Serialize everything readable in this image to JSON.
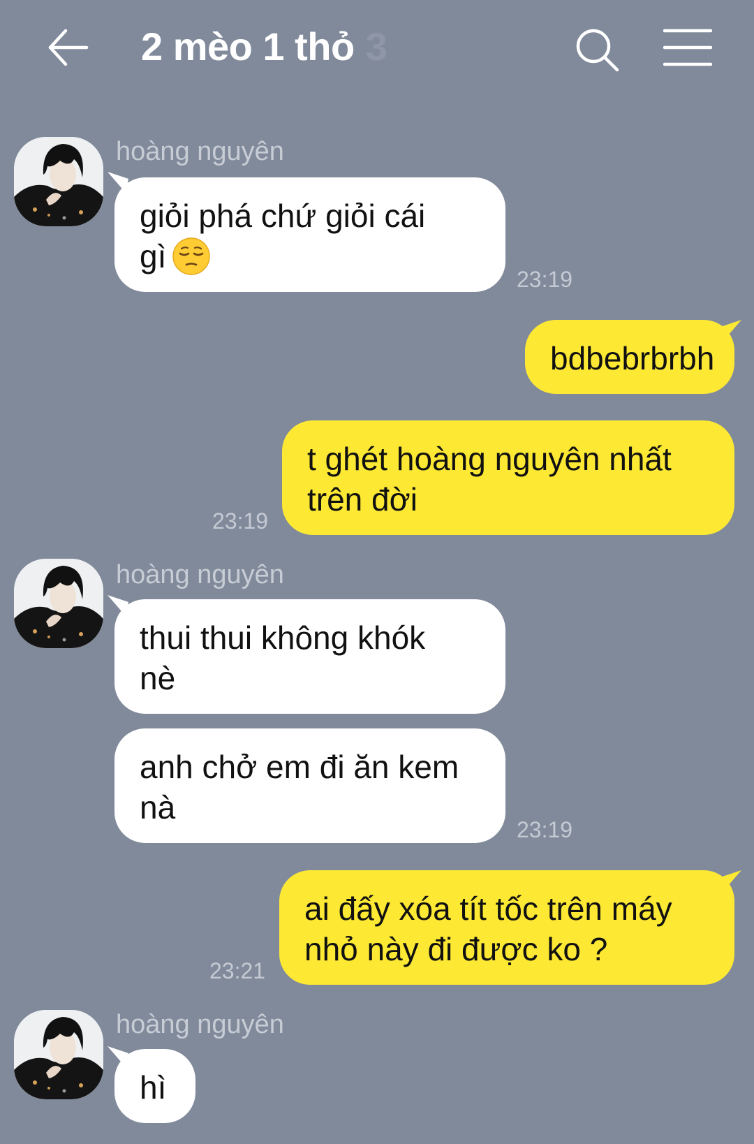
{
  "header": {
    "title": "2 mèo 1 thỏ",
    "member_count": "3",
    "back_icon": "arrow-left-icon",
    "search_icon": "search-icon",
    "menu_icon": "hamburger-menu-icon"
  },
  "colors": {
    "background": "#818a9b",
    "incoming_bubble": "#ffffff",
    "outgoing_bubble": "#fde934"
  },
  "messages": [
    {
      "direction": "incoming",
      "sender": "hoàng nguyên",
      "lines": [
        "giỏi phá chứ giỏi cái",
        "gì"
      ],
      "emoji": "pensive-face-emoji",
      "time": "23:19"
    },
    {
      "direction": "outgoing",
      "lines": [
        "bdbebrbrbh"
      ]
    },
    {
      "direction": "outgoing",
      "lines": [
        "t ghét hoàng nguyên nhất",
        "trên đời"
      ],
      "time": "23:19"
    },
    {
      "direction": "incoming",
      "sender": "hoàng nguyên",
      "lines": [
        "thui thui không khók",
        "nè"
      ]
    },
    {
      "direction": "incoming",
      "lines": [
        "anh chở em đi ăn kem",
        "nà"
      ],
      "time": "23:19"
    },
    {
      "direction": "outgoing",
      "lines": [
        "ai đấy xóa tít tốc trên máy",
        "nhỏ này đi được ko ?"
      ],
      "time": "23:21"
    },
    {
      "direction": "incoming",
      "sender": "hoàng nguyên",
      "lines": [
        "hì"
      ]
    }
  ]
}
